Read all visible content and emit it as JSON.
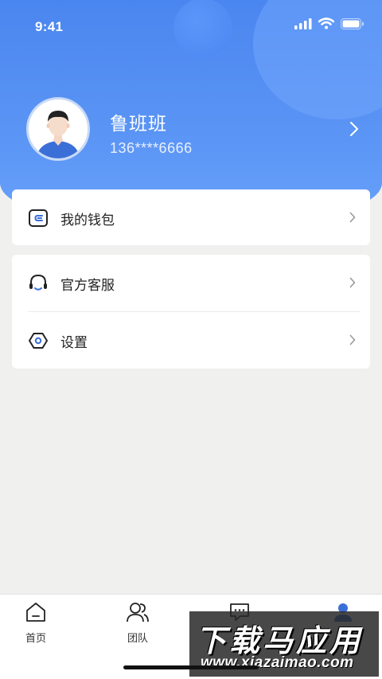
{
  "status_bar": {
    "time": "9:41"
  },
  "profile": {
    "name": "鲁班班",
    "phone": "136****6666"
  },
  "menu": {
    "wallet": {
      "label": "我的钱包",
      "icon": "wallet-icon"
    },
    "service": {
      "label": "官方客服",
      "icon": "headset-icon"
    },
    "settings": {
      "label": "设置",
      "icon": "hexagon-settings-icon"
    }
  },
  "tabs": [
    {
      "label": "首页",
      "icon": "home-icon"
    },
    {
      "label": "团队",
      "icon": "team-icon"
    },
    {
      "label": "",
      "icon": "message-icon"
    },
    {
      "label": "",
      "icon": "profile-icon"
    }
  ],
  "watermark": {
    "title": "下载马应用",
    "url": "www.xiazaimao.com"
  },
  "colors": {
    "accent": "#4a86ef",
    "page_bg": "#f0f0ef"
  }
}
